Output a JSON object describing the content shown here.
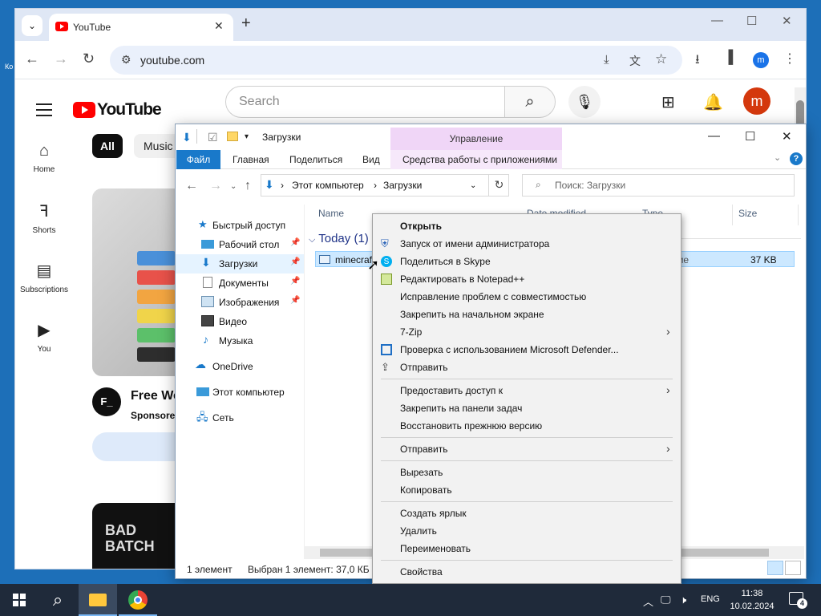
{
  "desktop": {
    "edge_text": "Ко"
  },
  "chrome": {
    "tab_title": "YouTube",
    "url": "youtube.com",
    "profile_initial": "m"
  },
  "youtube": {
    "logo_text": "YouTube",
    "search_placeholder": "Search",
    "avatar_initial": "m",
    "sidebar": [
      "Home",
      "Shorts",
      "Subscriptions",
      "You"
    ],
    "chips": [
      "All",
      "Music"
    ],
    "video": {
      "channel_initial": "F_",
      "title": "Free We",
      "sponsored": "Sponsored"
    },
    "thumb2_text": "BAD BATCH"
  },
  "explorer": {
    "title": "Загрузки",
    "context_tab": "Управление",
    "context_sub": "Средства работы с приложениями",
    "ribbon_tabs": [
      "Файл",
      "Главная",
      "Поделиться",
      "Вид"
    ],
    "breadcrumb": [
      "Этот компьютер",
      "Загрузки"
    ],
    "search_placeholder": "Поиск: Загрузки",
    "nav": {
      "quick_access": "Быстрый доступ",
      "desktop": "Рабочий стол",
      "downloads": "Загрузки",
      "documents": "Документы",
      "pictures": "Изображения",
      "video": "Видео",
      "music": "Музыка",
      "onedrive": "OneDrive",
      "this_pc": "Этот компьютер",
      "network": "Сеть"
    },
    "columns": {
      "name": "Name",
      "date": "Date modified",
      "type": "Type",
      "size": "Size"
    },
    "group": "Today (1)",
    "file": {
      "name": "minecraf",
      "type": "иложение",
      "size": "37 KB"
    },
    "status": {
      "count": "1 элемент",
      "selected": "Выбран 1 элемент: 37,0 КБ"
    }
  },
  "context_menu": {
    "group1": [
      {
        "label": "Открыть",
        "bold": true,
        "icon": ""
      },
      {
        "label": "Запуск от имени администратора",
        "icon": "shield-icon"
      },
      {
        "label": "Поделиться в Skype",
        "icon": "skype-icon"
      },
      {
        "label": "Редактировать в Notepad++",
        "icon": "notepad-icon"
      },
      {
        "label": "Исправление проблем с совместимостью",
        "icon": ""
      },
      {
        "label": "Закрепить на начальном экране",
        "icon": ""
      },
      {
        "label": "7-Zip",
        "icon": "",
        "submenu": true
      },
      {
        "label": "Проверка с использованием Microsoft Defender...",
        "icon": "defender-icon"
      },
      {
        "label": "Отправить",
        "icon": "share-icon"
      }
    ],
    "group2": [
      {
        "label": "Предоставить доступ к",
        "submenu": true
      },
      {
        "label": "Закрепить на панели задач"
      },
      {
        "label": "Восстановить прежнюю версию"
      }
    ],
    "group3": [
      {
        "label": "Отправить",
        "submenu": true
      }
    ],
    "group4": [
      {
        "label": "Вырезать"
      },
      {
        "label": "Копировать"
      }
    ],
    "group5": [
      {
        "label": "Создать ярлык"
      },
      {
        "label": "Удалить"
      },
      {
        "label": "Переименовать"
      }
    ],
    "group6": [
      {
        "label": "Свойства"
      }
    ]
  },
  "taskbar": {
    "language": "ENG",
    "time": "11:38",
    "date": "10.02.2024",
    "notifications": "4"
  }
}
